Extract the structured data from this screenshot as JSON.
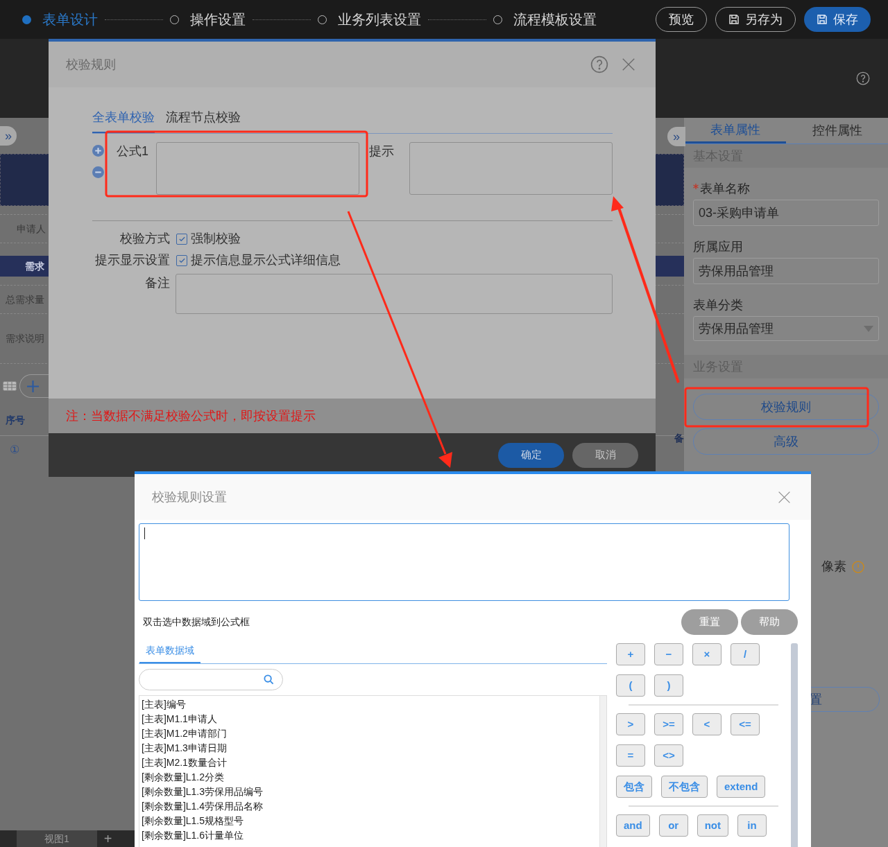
{
  "top_bar": {
    "steps": [
      {
        "label": "表单设计",
        "selected": true
      },
      {
        "label": "操作设置",
        "selected": false
      },
      {
        "label": "业务列表设置",
        "selected": false
      },
      {
        "label": "流程模板设置",
        "selected": false
      }
    ],
    "buttons": [
      {
        "label": "预览",
        "kind": "outline"
      },
      {
        "label": "另存为",
        "kind": "save-as"
      },
      {
        "label": "保存",
        "kind": "primary"
      }
    ]
  },
  "canvas": {
    "rows": [
      {
        "label": "申请人",
        "kind": "field"
      },
      {
        "label": "需求",
        "kind": "band"
      },
      {
        "label": "总需求量",
        "kind": "field"
      },
      {
        "label": "需求说明",
        "kind": "tall"
      }
    ],
    "expand_handle": "»",
    "table_header": "序号",
    "row_number": "①",
    "side_label": "备",
    "view_tab": "视图1",
    "add_tab": "+"
  },
  "property_panel": {
    "tabs": [
      {
        "label": "表单属性",
        "selected": true
      },
      {
        "label": "控件属性",
        "selected": false
      }
    ],
    "sections": [
      {
        "title": "基本设置",
        "fields": [
          {
            "label": "表单名称",
            "required": true,
            "value": "03-采购申请单",
            "kind": "input"
          },
          {
            "label": "所属应用",
            "required": false,
            "value": "劳保用品管理",
            "kind": "input"
          },
          {
            "label": "表单分类",
            "required": false,
            "value": "劳保用品管理",
            "kind": "select"
          }
        ]
      },
      {
        "title": "业务设置",
        "buttons": [
          "校验规则",
          "高级"
        ]
      }
    ],
    "expand_handle": "»",
    "unit_label": "像素",
    "extra_button": "置"
  },
  "rule_dialog": {
    "title": "校验规则",
    "tabs": [
      {
        "label": "全表单校验",
        "selected": true
      },
      {
        "label": "流程节点校验",
        "selected": false
      }
    ],
    "formula_label": "公式1",
    "hint_label": "提示",
    "options": [
      {
        "label": "校验方式",
        "option": "强制校验",
        "checked": true
      },
      {
        "label": "提示显示设置",
        "option": "提示信息显示公式详细信息",
        "checked": true
      }
    ],
    "remark_label": "备注",
    "note": "注：当数据不满足校验公式时，即按设置提示",
    "buttons": [
      {
        "label": "确定",
        "kind": "primary"
      },
      {
        "label": "取消",
        "kind": "secondary"
      }
    ]
  },
  "formula_dialog": {
    "title": "校验规则设置",
    "hint": "双击选中数据域到公式框",
    "buttons": [
      "重置",
      "帮助"
    ],
    "tabs": [
      {
        "label": "表单数据域",
        "selected": true
      }
    ],
    "fields": [
      "[主表]编号",
      "[主表]M1.1申请人",
      "[主表]M1.2申请部门",
      "[主表]M1.3申请日期",
      "[主表]M2.1数量合计",
      "[剩余数量]L1.2分类",
      "[剩余数量]L1.3劳保用品编号",
      "[剩余数量]L1.4劳保用品名称",
      "[剩余数量]L1.5规格型号",
      "[剩余数量]L1.6计量单位"
    ],
    "operator_rows": [
      {
        "kind": "buttons",
        "items": [
          "+",
          "−",
          "×",
          "/"
        ]
      },
      {
        "kind": "buttons",
        "items": [
          "(",
          ")"
        ]
      },
      {
        "kind": "divider"
      },
      {
        "kind": "buttons",
        "items": [
          ">",
          ">=",
          "<",
          "<="
        ]
      },
      {
        "kind": "buttons",
        "items": [
          "=",
          "<>"
        ]
      },
      {
        "kind": "buttons",
        "items": [
          "包含",
          "不包含",
          "extend"
        ]
      },
      {
        "kind": "divider"
      },
      {
        "kind": "buttons",
        "items": [
          "and",
          "or",
          "not",
          "in"
        ]
      }
    ]
  }
}
